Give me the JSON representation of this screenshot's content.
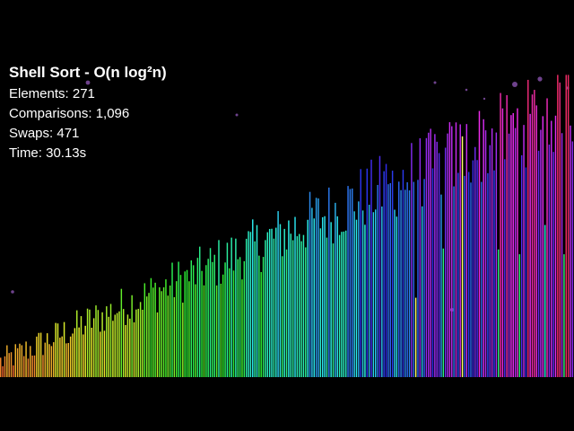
{
  "overlay": {
    "title": "Shell Sort - O(n log²n)",
    "elements_text": "Elements: 271",
    "comparisons_text": "Comparisons: 1,096",
    "swaps_text": "Swaps: 471",
    "time_text": "Time: 30.13s"
  },
  "stats": {
    "elements": 271,
    "comparisons": 1096,
    "swaps": 471,
    "time_seconds": 30.13
  },
  "colors": {
    "background": "#000000",
    "text": "#ffffff",
    "highlight": "#ffff66",
    "palette": "rainbow-hue-by-value"
  },
  "highlighted_bars": [
    196,
    218
  ]
}
